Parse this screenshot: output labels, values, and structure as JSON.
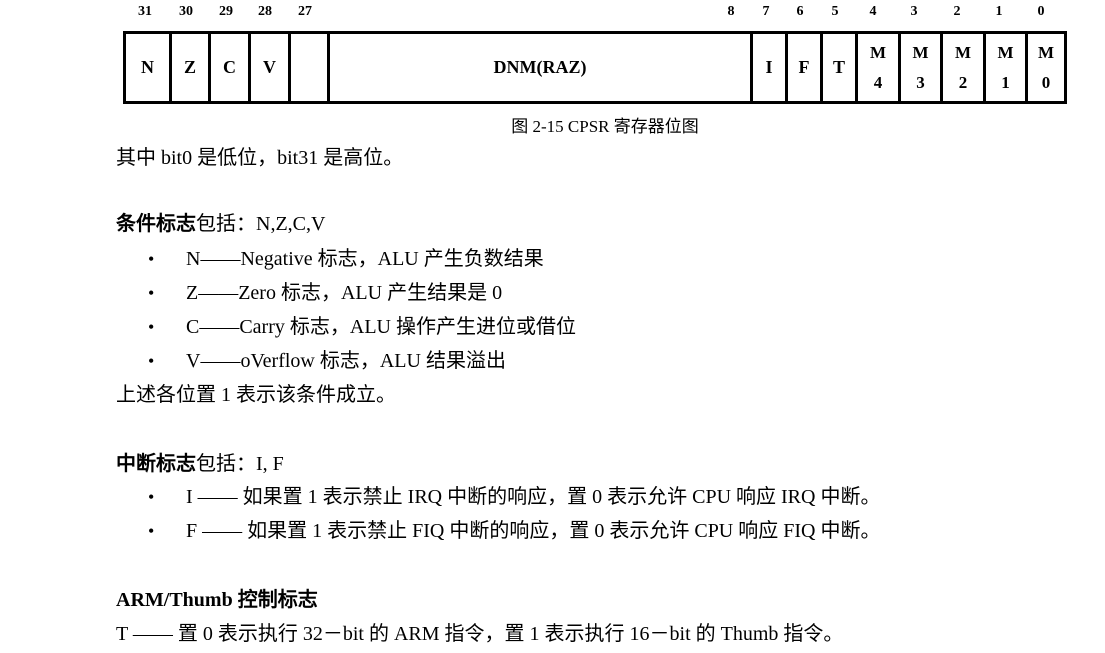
{
  "figure": {
    "bit_numbers": [
      "31",
      "30",
      "29",
      "28",
      "27",
      "8",
      "7",
      "6",
      "5",
      "4",
      "3",
      "2",
      "1",
      "0"
    ],
    "cells": [
      {
        "label": "N"
      },
      {
        "label": "Z"
      },
      {
        "label": "C"
      },
      {
        "label": "V"
      },
      {
        "label": ""
      },
      {
        "label": "DNM(RAZ)"
      },
      {
        "label": "I"
      },
      {
        "label": "F"
      },
      {
        "label": "T"
      },
      {
        "label_top": "M",
        "label_bottom": "4"
      },
      {
        "label_top": "M",
        "label_bottom": "3"
      },
      {
        "label_top": "M",
        "label_bottom": "2"
      },
      {
        "label_top": "M",
        "label_bottom": "1"
      },
      {
        "label_top": "M",
        "label_bottom": "0"
      }
    ],
    "caption": "图 2-15 CPSR 寄存器位图"
  },
  "intro": "其中 bit0 是低位，bit31 是高位。",
  "condition_flags": {
    "heading": "条件标志",
    "heading_suffix": "包括：N,Z,C,V",
    "items": [
      "N——Negative 标志，ALU 产生负数结果",
      "Z——Zero 标志，ALU 产生结果是 0",
      "C——Carry 标志，ALU 操作产生进位或借位",
      "V——oVerflow 标志，ALU 结果溢出"
    ],
    "note": "上述各位置 1 表示该条件成立。"
  },
  "interrupt_flags": {
    "heading": "中断标志",
    "heading_suffix": "包括：I, F",
    "items": [
      "I —— 如果置 1 表示禁止 IRQ 中断的响应，置 0 表示允许 CPU 响应 IRQ 中断。",
      "F —— 如果置 1 表示禁止 FIQ 中断的响应，置 0 表示允许 CPU 响应 FIQ 中断。"
    ]
  },
  "thumb_flag": {
    "heading": "ARM/Thumb 控制标志",
    "text": "T —— 置 0 表示执行 32－bit 的 ARM 指令，置 1 表示执行 16－bit 的 Thumb 指令。"
  }
}
